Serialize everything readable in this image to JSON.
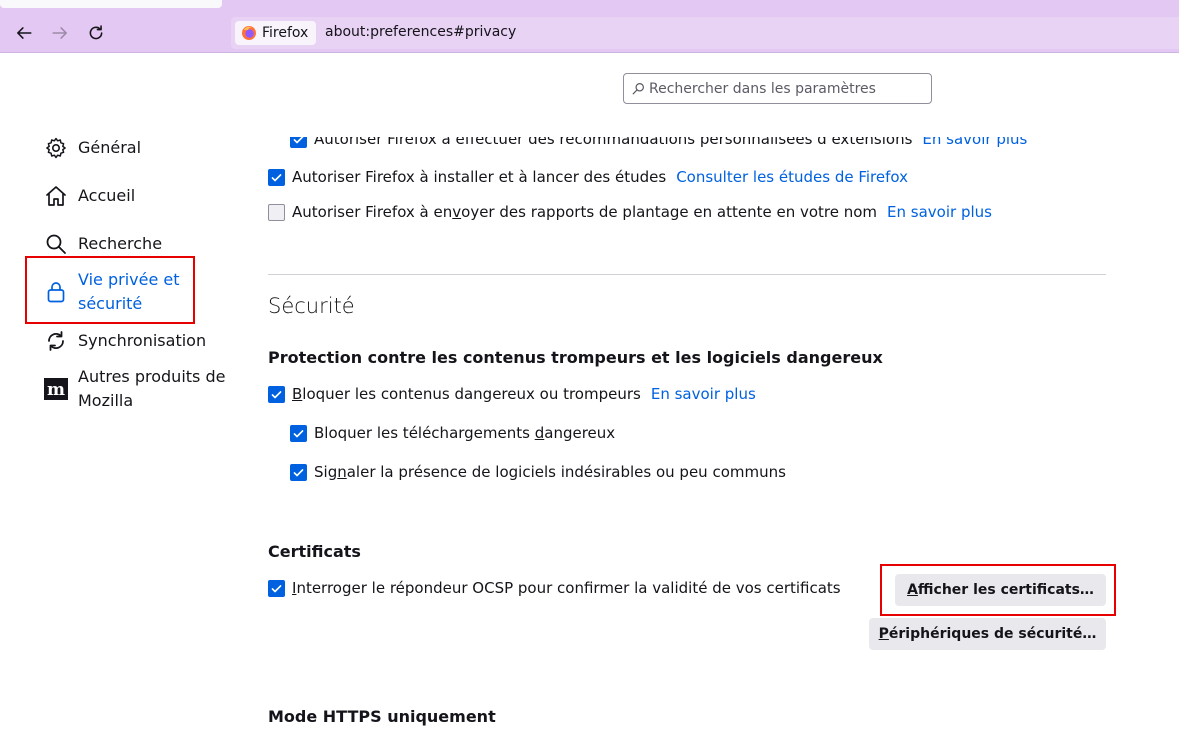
{
  "browser": {
    "identity_label": "Firefox",
    "url": "about:preferences#privacy"
  },
  "search": {
    "placeholder": "Rechercher dans les paramètres"
  },
  "sidebar": {
    "items": [
      {
        "label": "Général",
        "icon": "gear-icon"
      },
      {
        "label": "Accueil",
        "icon": "home-icon"
      },
      {
        "label": "Recherche",
        "icon": "search-icon"
      },
      {
        "label": "Vie privée et sécurité",
        "line1": "Vie privée et",
        "line2": "sécurité",
        "icon": "lock-icon",
        "selected": true
      },
      {
        "label": "Synchronisation",
        "icon": "sync-icon"
      },
      {
        "label": "Autres produits de Mozilla",
        "line1": "Autres produits de",
        "line2": "Mozilla",
        "icon": "mozilla-icon"
      }
    ]
  },
  "data_collection": {
    "recommendations": {
      "label": "Autoriser Firefox à effectuer des recommandations personnalisées d’extensions",
      "link": "En savoir plus",
      "checked": true
    },
    "studies": {
      "label": "Autoriser Firefox à installer et à lancer des études",
      "link": "Consulter les études de Firefox",
      "checked": true
    },
    "crash_reports": {
      "label_pre": "Autoriser Firefox à en",
      "label_key": "v",
      "label_post": "oyer des rapports de plantage en attente en votre nom",
      "link": "En savoir plus",
      "checked": false
    }
  },
  "security": {
    "title": "Sécurité",
    "protection_heading": "Protection contre les contenus trompeurs et les logiciels dangereux",
    "block_dangerous": {
      "key": "B",
      "rest": "loquer les contenus dangereux ou trompeurs",
      "link": "En savoir plus",
      "checked": true
    },
    "block_downloads": {
      "pre": "Bloquer les téléchargements ",
      "key": "d",
      "post": "angereux",
      "checked": true
    },
    "warn_unwanted": {
      "pre": "Sig",
      "key": "n",
      "post": "aler la présence de logiciels indésirables ou peu communs",
      "checked": true
    },
    "certificates_heading": "Certificats",
    "ocsp": {
      "key": "I",
      "rest": "nterroger le répondeur OCSP pour confirmer la validité de vos certificats",
      "checked": true
    },
    "view_certificates_button": {
      "key": "A",
      "rest": "fficher les certificats…"
    },
    "security_devices_button": {
      "key": "P",
      "rest": "ériphériques de sécurité…"
    },
    "https_heading": "Mode HTTPS uniquement"
  },
  "colors": {
    "accent": "#0061e0",
    "highlight": "#e60000",
    "chrome": "#e3c8f3"
  }
}
